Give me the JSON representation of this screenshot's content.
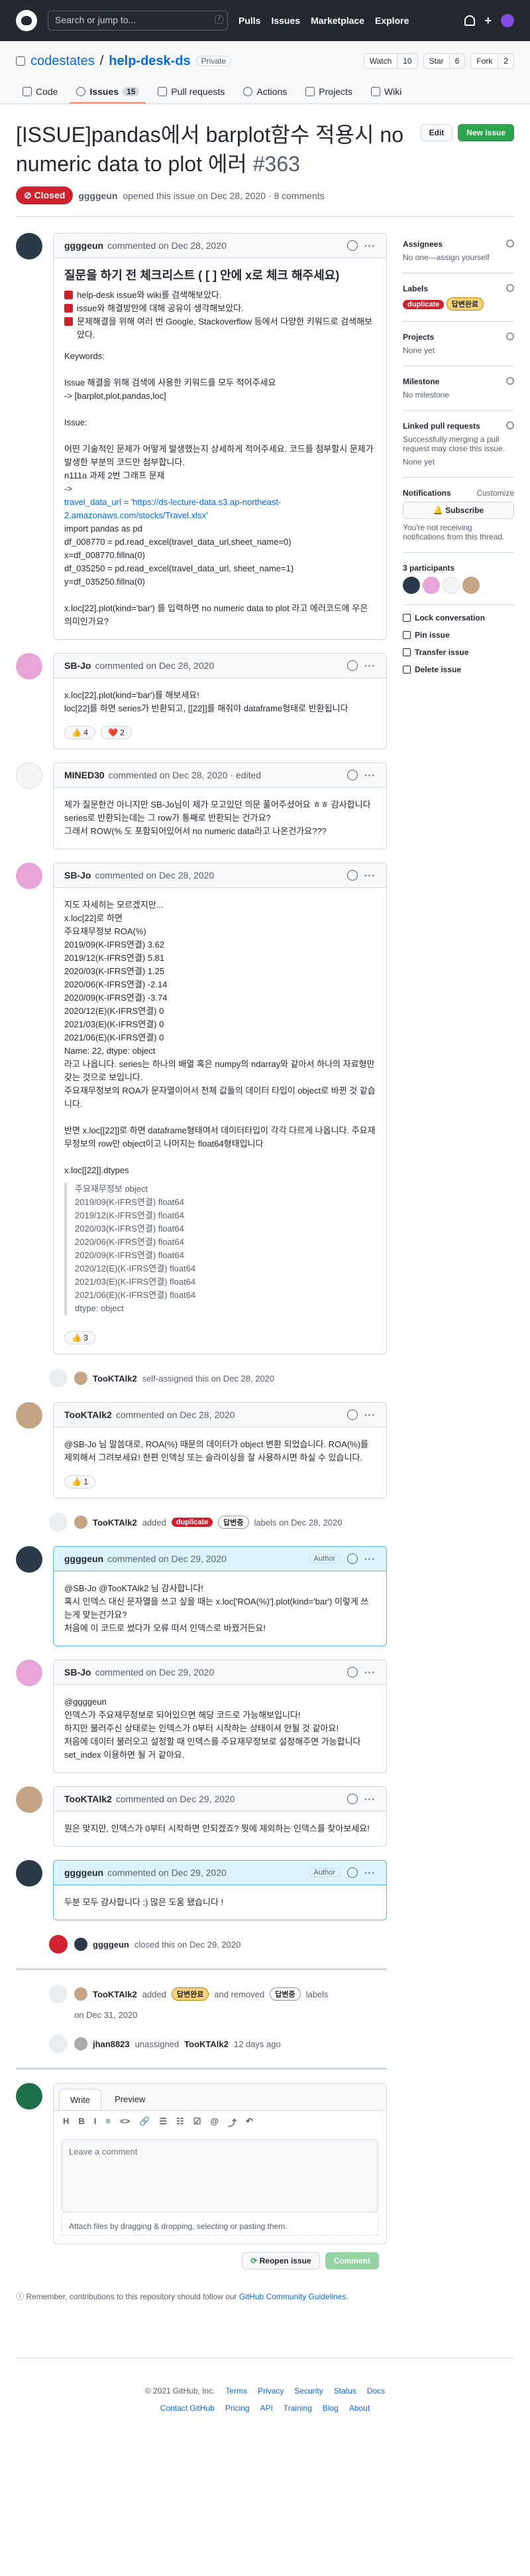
{
  "header": {
    "search_placeholder": "Search or jump to...",
    "slash": "/",
    "nav": [
      "Pulls",
      "Issues",
      "Marketplace",
      "Explore"
    ],
    "plus": "+"
  },
  "repo": {
    "owner": "codestates",
    "sep": "/",
    "name": "help-desk-ds",
    "visibility": "Private",
    "watch": "Watch",
    "watch_count": "10",
    "star": "Star",
    "star_count": "6",
    "fork": "Fork",
    "fork_count": "2",
    "tabs": [
      {
        "label": "Code"
      },
      {
        "label": "Issues",
        "count": "15"
      },
      {
        "label": "Pull requests"
      },
      {
        "label": "Actions"
      },
      {
        "label": "Projects"
      },
      {
        "label": "Wiki"
      }
    ]
  },
  "issue": {
    "title": "[ISSUE]pandas에서 barplot함수 적용시 no numeric data to plot 에러",
    "number": "#363",
    "edit": "Edit",
    "new_issue": "New issue",
    "state": "Closed",
    "author": "ggggeun",
    "meta": "opened this issue on Dec 28, 2020 · 8 comments"
  },
  "comments": [
    {
      "author": "ggggeun",
      "date": "commented on Dec 28, 2020",
      "heading": "질문을 하기 전 체크리스트 ( [ ] 안에 x로 체크 해주세요)",
      "checks": [
        "help-desk issue와 wiki를 검색해보았다.",
        "issue와 해결방안에 대해 공유이 생각해보았다.",
        "문제해결을 위해 여러 번 Google, Stackoverflow 등에서 다양한 키워드로 검색해보았다."
      ],
      "body": "Keywords:\n\nIssue 해결을 위해 검색에 사용한 키워드를 모두 적어주세요\n-> [barplot,plot,pandas,loc]\n\nIssue:\n\n어떤 기술적인 문제가 어떻게 발생했는지 상세하게 적어주세요. 코드를 첨부할시 문제가 발생한 부분의 코드만 첨부합니다.\nn111a 과제 2번 그래프 문제\n->",
      "link": "travel_data_url = 'https://ds-lecture-data.s3.ap-northeast-2.amazonaws.com/stocks/Travel.xlsx'",
      "code": "import pandas as pd\ndf_008770 = pd.read_excel(travel_data_url,sheet_name=0)\nx=df_008770.fillna(0)\ndf_035250 = pd.read_excel(travel_data_url, sheet_name=1)\ny=df_035250.fillna(0)\n\nx.loc[22].plot(kind='bar') 를 입력하면 no numeric data to plot 라고 에러코드에 우은 의미인가요?"
    },
    {
      "author": "SB-Jo",
      "date": "commented on Dec 28, 2020",
      "body": "x.loc[22].plot(kind='bar')를 해보세요!\nloc[22]를 하면 series가 반환되고, [[22]]를 해줘야 dataframe형태로 반환됩니다",
      "reactions": [
        "👍 4",
        "❤️ 2"
      ]
    },
    {
      "author": "MINED30",
      "date": "commented on Dec 28, 2020 · edited",
      "body": "제가 질문한건 아니지만 SB-Jo님이 제가 모고있던 의문 풀어주셨어요 ㅎㅎ 감사합니다\nseries로 반환되는데는 그 row가 통째로 반환되는 건가요?\n그래서 ROW(% 도 포함되어있어서 no numeric data라고 나온건가요???"
    },
    {
      "author": "SB-Jo",
      "date": "commented on Dec 28, 2020",
      "body": "지도 자세히는 모르겠지만...\nx.loc[22]로 하면\n주요재무정보 ROA(%)\n2019/09(K-IFRS연결) 3.62\n2019/12(K-IFRS연결) 5.81\n2020/03(K-IFRS연결) 1.25\n2020/06(K-IFRS연결) -2.14\n2020/09(K-IFRS연결) -3.74\n2020/12(E)(K-IFRS연결) 0\n2021/03(E)(K-IFRS연결) 0\n2021/06(E)(K-IFRS연결) 0\nName: 22, dtype: object\n라고 나옵니다. series는 하나의 배열 혹은 numpy의 ndarray와 같아서 하나의 자료형만 갖는 것으로 보입니다.\n주요재무정보의 ROA가 문자열이어서 전체 값들의 데이터 타입이 object로 바뀐 것 같습니다.\n\n반면 x.loc[[22]]로 하면 dataframe형태여서 데이터타입이 각각 다르게 나옵니다. 주요재무정보의 row만 object이고 나머지는 float64형태입니다\n\nx.loc[[22]].dtypes",
      "quote": "주요재무정보 object\n2019/09(K-IFRS연결) float64\n2019/12(K-IFRS연결) float64\n2020/03(K-IFRS연결) float64\n2020/06(K-IFRS연결) float64\n2020/09(K-IFRS연결) float64\n2020/12(E)(K-IFRS연결) float64\n2021/03(E)(K-IFRS연결) float64\n2021/06(E)(K-IFRS연결) float64\ndtype: object",
      "reactions": [
        "👍 3"
      ]
    },
    {
      "author": "TooKTAlk2",
      "date": "commented on Dec 28, 2020",
      "body": "@SB-Jo 님 말씀대로, ROA(%) 때문의 데이터가 object 변환 되었습니다. ROA(%)를 제외해서 그려보세요! 한편 인덱싱 또는 슬라이싱을 잘 사용하시면 하실 수 있습니다.",
      "reactions": [
        "👍 1"
      ]
    },
    {
      "author": "ggggeun",
      "date": "commented on Dec 29, 2020",
      "tag": "Author",
      "body": "@SB-Jo @TooKTAlk2 님 감사합니다!\n혹시 인덱스 대신 문자열을 쓰고 싶을 때는 x.loc['ROA(%)'].plot(kind='bar') 이렇게 쓰는게 맞는건가요?\n처음에 이 코드로 썼다가 오류 떠서 인덱스로 바꿨거든요!"
    },
    {
      "author": "SB-Jo",
      "date": "commented on Dec 29, 2020",
      "body": "@ggggeun\n인덱스가 주요재무정보로 되어있으면 해당 코드로 가능해보입니다!\n하지만 불러주신 상태로는 인덱스가 0부터 시작하는 상태이셔 안될 것 같아요!\n처음에 데이터 불러오고 설정할 때 인덱스를 주요재무정보로 설정해주면 가능합니다\nset_index 이용하면 될 거 같아요."
    },
    {
      "author": "TooKTAlk2",
      "date": "commented on Dec 29, 2020",
      "body": "뭔은 맞지만, 인덱스가 0부터 시작하면 안되겠죠? 뭣에 제외하는 인덱스를 찾아보세요!"
    },
    {
      "author": "ggggeun",
      "date": "commented on Dec 29, 2020",
      "tag": "Author",
      "body": "두분 모두 감사합니다 :) 많은 도움 됐습니다 !"
    }
  ],
  "events": {
    "assigned": {
      "author": "TooKTAlk2",
      "text": "self-assigned this on Dec 28, 2020"
    },
    "labeled": {
      "author": "TooKTAlk2",
      "verb": "added",
      "label1": "duplicate",
      "label2": "답변중",
      "text": "labels on Dec 28, 2020"
    },
    "closed": {
      "author": "ggggeun",
      "text": "closed this on Dec 29, 2020"
    },
    "relabeled": {
      "author": "TooKTAlk2",
      "verb": "added",
      "label1": "답변완료",
      "mid": "and removed",
      "label2": "답변중",
      "text": "labels",
      "date": "on Dec 31, 2020"
    },
    "unassigned": {
      "author": "jhan8823",
      "verb": "unassigned",
      "target": "TooKTAlk2",
      "text": "12 days ago"
    }
  },
  "sidebar": {
    "assignees": "Assignees",
    "assignees_val": "No one—assign yourself",
    "labels": "Labels",
    "label1": "duplicate",
    "label2": "답변완료",
    "projects": "Projects",
    "projects_val": "None yet",
    "milestone": "Milestone",
    "milestone_val": "No milestone",
    "linked": "Linked pull requests",
    "linked_val": "Successfully merging a pull request may close this issue.",
    "linked_none": "None yet",
    "notifications": "Notifications",
    "customize": "Customize",
    "subscribe": "Subscribe",
    "notif_text": "You're not receiving notifications from this thread.",
    "participants": "3 participants",
    "lock": "Lock conversation",
    "pin": "Pin issue",
    "transfer": "Transfer issue",
    "delete": "Delete issue"
  },
  "editor": {
    "write": "Write",
    "preview": "Preview",
    "toolbar": [
      "H",
      "B",
      "I",
      "≡",
      "<>",
      "🔗",
      "☰",
      "☷",
      "☑",
      "@",
      "⤴",
      "↶"
    ],
    "placeholder": "Leave a comment",
    "attach": "Attach files by dragging & dropping, selecting or pasting them.",
    "reopen": "Reopen issue",
    "comment": "Comment"
  },
  "remember": {
    "text": "Remember, contributions to this repository should follow our",
    "link": "GitHub Community Guidelines",
    "end": "."
  },
  "footer": {
    "copyright": "© 2021 GitHub, Inc.",
    "links": [
      "Terms",
      "Privacy",
      "Security",
      "Status",
      "Docs",
      "Contact GitHub",
      "Pricing",
      "API",
      "Training",
      "Blog",
      "About"
    ]
  }
}
